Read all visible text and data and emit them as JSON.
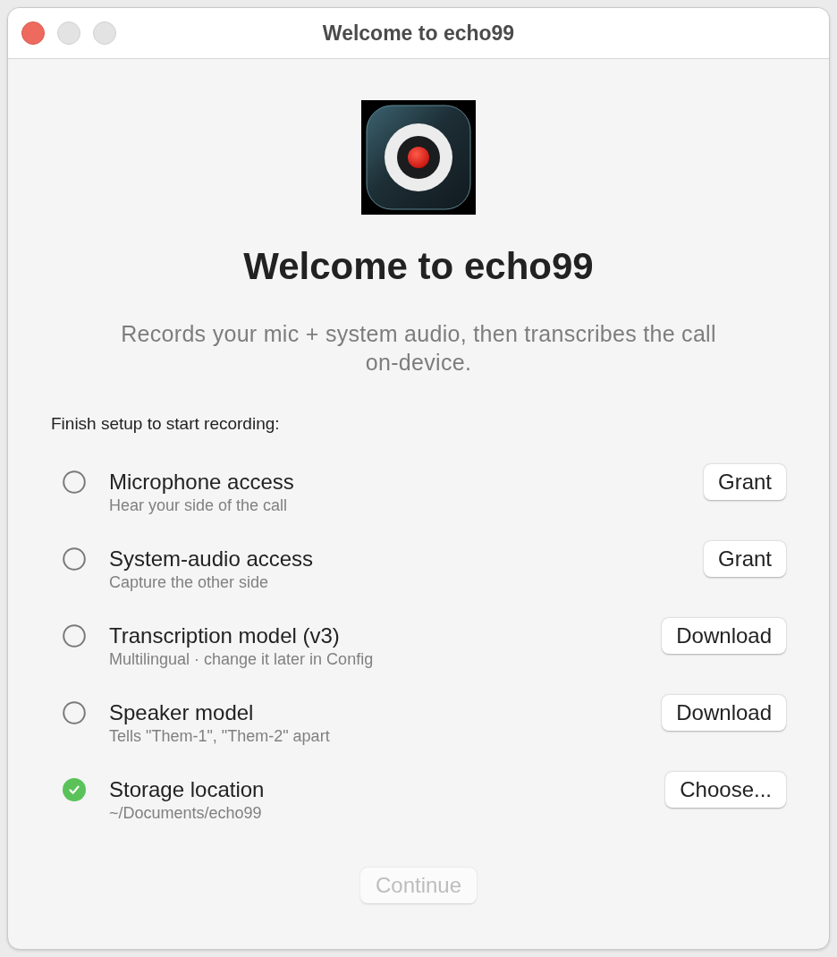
{
  "window": {
    "title": "Welcome to echo99",
    "controls": [
      {
        "kind": "close",
        "disabled": false
      },
      {
        "kind": "minimize",
        "disabled": true
      },
      {
        "kind": "zoom",
        "disabled": true
      }
    ]
  },
  "heading": "Welcome to echo99",
  "subtitle": "Records your mic + system audio, then transcribes the call on-device.",
  "setup": {
    "label": "Finish setup to start recording:",
    "items": [
      {
        "title": "Microphone access",
        "detail": "Hear your side of the call",
        "done": false,
        "action": "Grant"
      },
      {
        "title": "System-audio access",
        "detail": "Capture the other side",
        "done": false,
        "action": "Grant"
      },
      {
        "title": "Transcription model (v3)",
        "detail": "Multilingual · change it later in Config",
        "done": false,
        "action": "Download"
      },
      {
        "title": "Speaker model",
        "detail": "Tells \"Them-1\", \"Them-2\" apart",
        "done": false,
        "action": "Download"
      },
      {
        "title": "Storage location",
        "detail": "~/Documents/echo99",
        "done": true,
        "action": "Choose..."
      }
    ]
  },
  "continue_button": {
    "label": "Continue",
    "disabled": true
  }
}
